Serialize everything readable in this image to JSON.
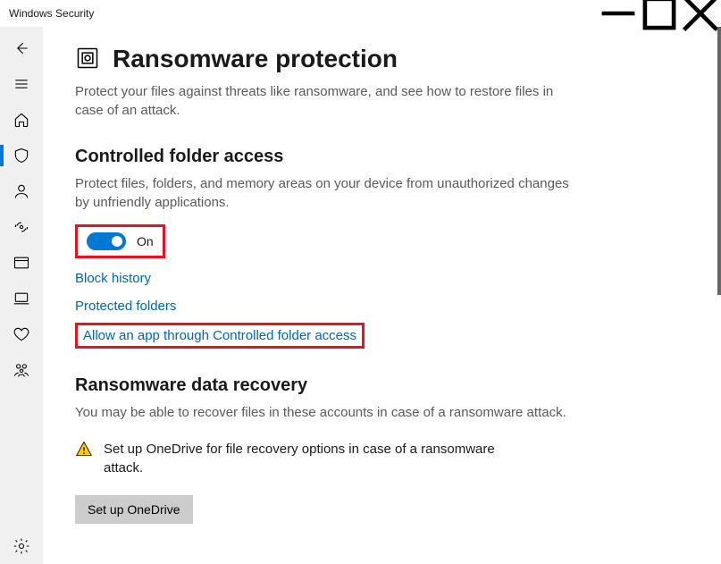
{
  "titlebar": {
    "app_name": "Windows Security"
  },
  "page": {
    "title": "Ransomware protection",
    "intro": "Protect your files against threats like ransomware, and see how to restore files in case of an attack."
  },
  "cfa": {
    "heading": "Controlled folder access",
    "desc": "Protect files, folders, and memory areas on your device from unauthorized changes by unfriendly applications.",
    "toggle_label": "On",
    "links": {
      "block_history": "Block history",
      "protected_folders": "Protected folders",
      "allow_app": "Allow an app through Controlled folder access"
    }
  },
  "recovery": {
    "heading": "Ransomware data recovery",
    "desc": "You may be able to recover files in these accounts in case of a ransomware attack.",
    "warn_text": "Set up OneDrive for file recovery options in case of a ransomware attack.",
    "button": "Set up OneDrive"
  }
}
